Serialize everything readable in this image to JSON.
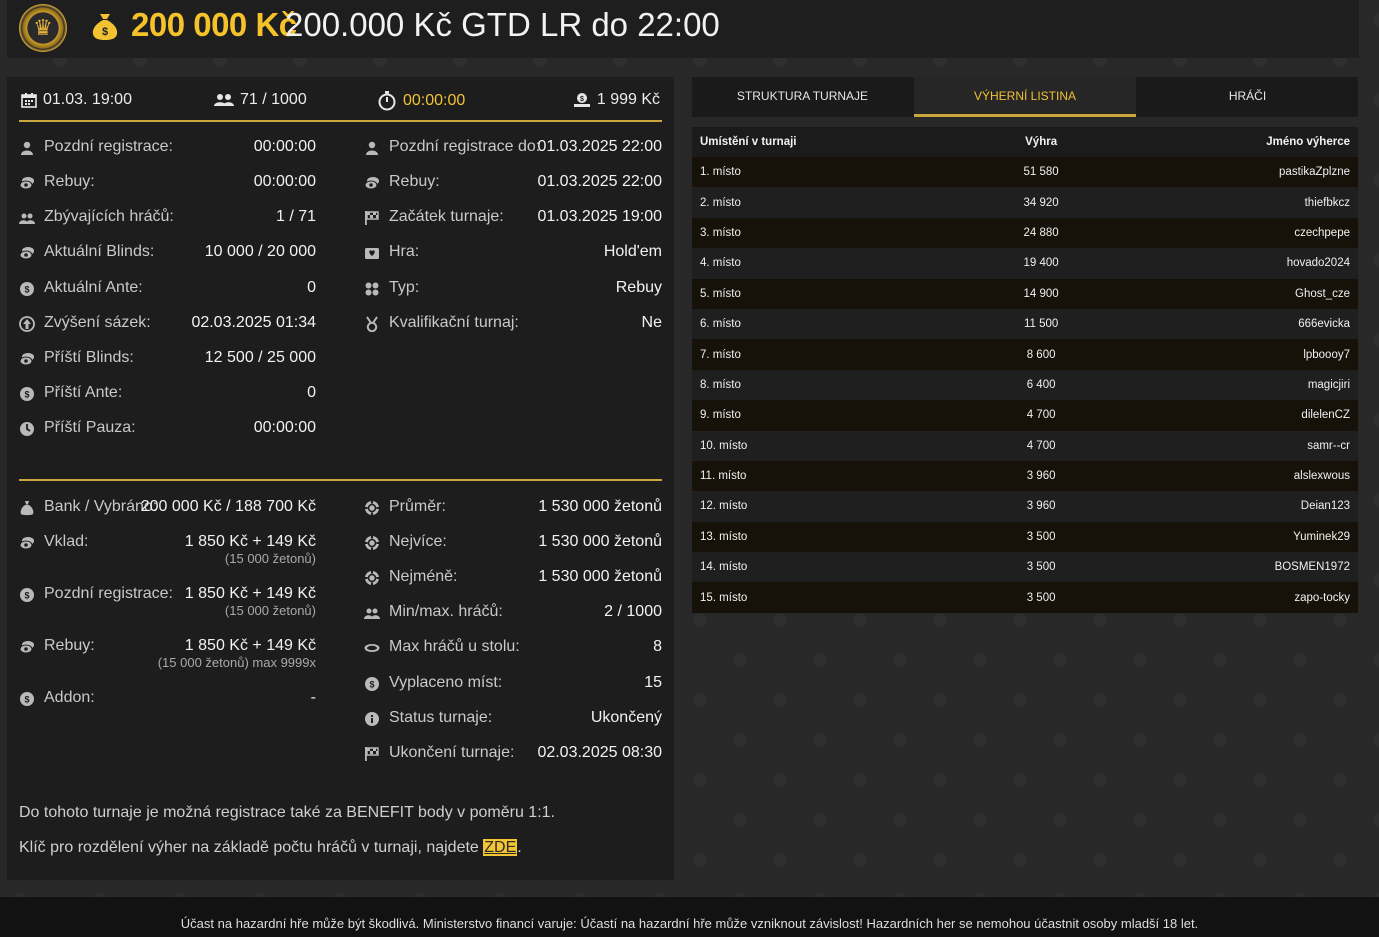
{
  "header": {
    "amount": "200 000 Kč",
    "title": "200.000 Kč GTD LR do 22:00"
  },
  "topbar": {
    "date": "01.03. 19:00",
    "players": "71 / 1000",
    "timer": "00:00:00",
    "fee": "1 999 Kč"
  },
  "left_col": [
    {
      "icon": "user-icon",
      "label": "Pozdní registrace:",
      "value": "00:00:00"
    },
    {
      "icon": "chips-icon",
      "label": "Rebuy:",
      "value": "00:00:00"
    },
    {
      "icon": "users-icon",
      "label": "Zbývajících hráčů:",
      "value": "1 / 71"
    },
    {
      "icon": "chips-icon",
      "label": "Aktuální Blinds:",
      "value": "10 000 / 20 000"
    },
    {
      "icon": "coin-icon",
      "label": "Aktuální Ante:",
      "value": "0"
    },
    {
      "icon": "arrow-up-icon",
      "label": "Zvýšení sázek:",
      "value": "02.03.2025 01:34"
    },
    {
      "icon": "chips-icon",
      "label": "Příští Blinds:",
      "value": "12 500 / 25 000"
    },
    {
      "icon": "coin-icon",
      "label": "Příští Ante:",
      "value": "0"
    },
    {
      "icon": "clock-icon",
      "label": "Příští Pauza:",
      "value": "00:00:00"
    }
  ],
  "right_col": [
    {
      "icon": "user-icon",
      "label": "Pozdní registrace do:",
      "value": "01.03.2025 22:00"
    },
    {
      "icon": "chips-icon",
      "label": "Rebuy:",
      "value": "01.03.2025 22:00"
    },
    {
      "icon": "flag-icon",
      "label": "Začátek turnaje:",
      "value": "01.03.2025 19:00"
    },
    {
      "icon": "cards-icon",
      "label": "Hra:",
      "value": "Hold'em"
    },
    {
      "icon": "suits-icon",
      "label": "Typ:",
      "value": "Rebuy"
    },
    {
      "icon": "medal-icon",
      "label": "Kvalifikační turnaj:",
      "value": "Ne"
    }
  ],
  "bottom_left": [
    {
      "icon": "bag-icon",
      "label": "Bank / Vybráno:",
      "value": "200 000 Kč / 188 700 Kč",
      "sub": ""
    },
    {
      "icon": "chips-icon",
      "label": "Vklad:",
      "value": "1 850 Kč + 149 Kč",
      "sub": "(15 000 žetonů)"
    },
    {
      "icon": "coin-icon",
      "label": "Pozdní registrace:",
      "value": "1 850 Kč + 149 Kč",
      "sub": "(15 000 žetonů)"
    },
    {
      "icon": "chips-icon",
      "label": "Rebuy:",
      "value": "1 850 Kč + 149 Kč",
      "sub": "(15 000 žetonů) max 9999x"
    },
    {
      "icon": "coin-icon",
      "label": "Addon:",
      "value": "-",
      "sub": ""
    }
  ],
  "bottom_right": [
    {
      "icon": "chip-icon",
      "label": "Průměr:",
      "value": "1 530 000 žetonů"
    },
    {
      "icon": "chip-icon",
      "label": "Nejvíce:",
      "value": "1 530 000 žetonů"
    },
    {
      "icon": "chip-icon",
      "label": "Nejméně:",
      "value": "1 530 000 žetonů"
    },
    {
      "icon": "users-icon",
      "label": "Min/max. hráčů:",
      "value": "2 / 1000"
    },
    {
      "icon": "table-icon",
      "label": "Max hráčů u stolu:",
      "value": "8"
    },
    {
      "icon": "coin-icon",
      "label": "Vyplaceno míst:",
      "value": "15"
    },
    {
      "icon": "info-icon",
      "label": "Status turnaje:",
      "value": "Ukončený"
    },
    {
      "icon": "flag-icon",
      "label": "Ukončení turnaje:",
      "value": "02.03.2025 08:30"
    }
  ],
  "notes": {
    "benefit": "Do tohoto turnaje je možná registrace také za BENEFIT body v poměru 1:1.",
    "key_text": "Klíč pro rozdělení výher na základě počtu hráčů v turnaji, najdete ",
    "key_link": "ZDE",
    "key_end": "."
  },
  "tabs": [
    {
      "label": "STRUKTURA TURNAJE"
    },
    {
      "label": "VÝHERNÍ LISTINA"
    },
    {
      "label": "HRÁČI"
    }
  ],
  "table": {
    "headers": [
      "Umístění v turnaji",
      "Výhra",
      "Jméno výherce"
    ],
    "rows": [
      [
        "1. místo",
        "51 580",
        "pastikaZplzne"
      ],
      [
        "2. místo",
        "34 920",
        "thiefbkcz"
      ],
      [
        "3. místo",
        "24 880",
        "czechpepe"
      ],
      [
        "4. místo",
        "19 400",
        "hovado2024"
      ],
      [
        "5. místo",
        "14 900",
        "Ghost_cze"
      ],
      [
        "6. místo",
        "11 500",
        "666evicka"
      ],
      [
        "7. místo",
        "8 600",
        "lpboooy7"
      ],
      [
        "8. místo",
        "6 400",
        "magicjiri"
      ],
      [
        "9. místo",
        "4 700",
        "dilelenCZ"
      ],
      [
        "10. místo",
        "4 700",
        "samr--cr"
      ],
      [
        "11. místo",
        "3 960",
        "alslexwous"
      ],
      [
        "12. místo",
        "3 960",
        "Deian123"
      ],
      [
        "13. místo",
        "3 500",
        "Yuminek29"
      ],
      [
        "14. místo",
        "3 500",
        "BOSMEN1972"
      ],
      [
        "15. místo",
        "3 500",
        "zapo-tocky"
      ]
    ]
  },
  "footer": "Účast na hazardní hře může být škodlivá. Ministerstvo financí varuje: Účastí na hazardní hře může vzniknout závislost! Hazardních her se nemohou účastnit osoby mladší 18 let."
}
